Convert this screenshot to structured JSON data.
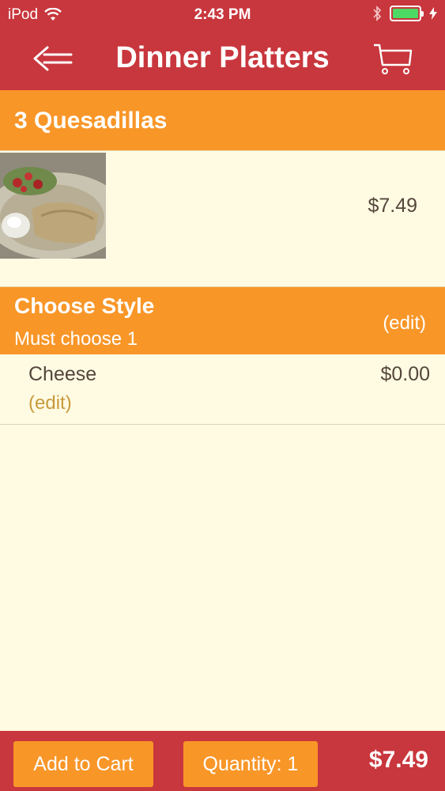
{
  "status": {
    "carrier": "iPod",
    "time": "2:43 PM",
    "battery_level": 1.0,
    "battery_color": "#4cd964"
  },
  "nav": {
    "title": "Dinner Platters",
    "back_icon": "back-arrow-icon",
    "cart_icon": "cart-icon"
  },
  "item": {
    "name": "3 Quesadillas",
    "price": "$7.49"
  },
  "style_group": {
    "title": "Choose Style",
    "subtitle": "Must choose 1",
    "edit_label": "(edit)"
  },
  "option": {
    "name": "Cheese",
    "price": "$0.00",
    "edit_label": "(edit)"
  },
  "footer": {
    "add_label": "Add to Cart",
    "quantity_label": "Quantity: 1",
    "total": "$7.49"
  },
  "colors": {
    "header_red": "#c8373d",
    "accent_orange": "#f89628",
    "background_cream": "#fffbe3",
    "text_brown": "#55463c",
    "edit_gold": "#c79a3d"
  }
}
